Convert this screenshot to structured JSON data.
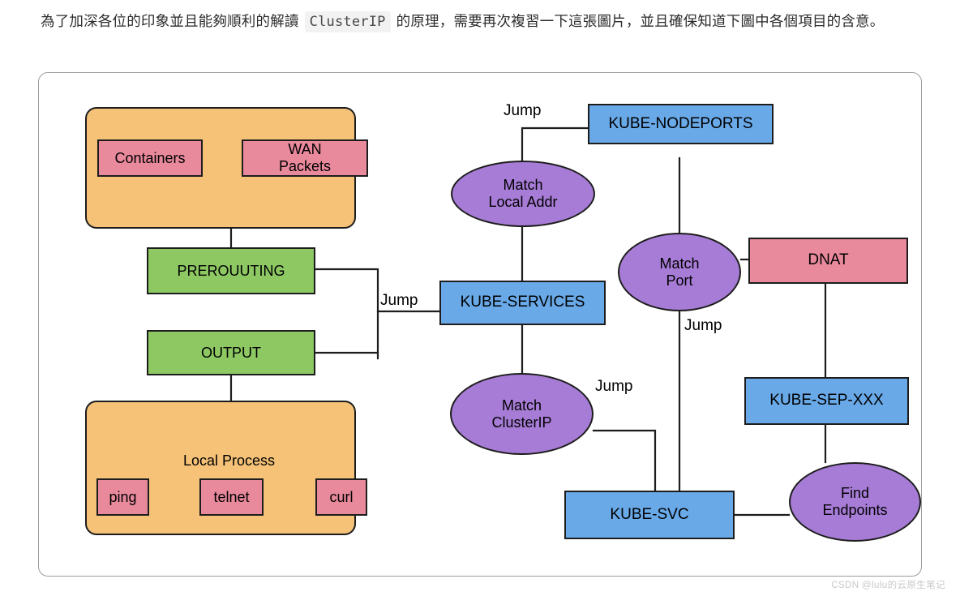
{
  "article": {
    "paragraph_part1": "為了加深各位的印象並且能夠順利的解讀 ",
    "inline_code": "ClusterIP",
    "paragraph_part2": " 的原理，需要再次複習一下這張圖片，並且確保知道下圖中各個項目的含意。"
  },
  "watermark": "CSDN @lulu的云原生笔记",
  "colors": {
    "group_orange": "#f5c278",
    "node_pink": "#e8899c",
    "node_green": "#8dc863",
    "node_blue": "#69a9e8",
    "node_purple": "#a77cd6",
    "stroke": "#1d1d1d",
    "card_border": "#9b9b9b"
  },
  "diagram": {
    "title": "Kubernetes ClusterIP iptables flow",
    "groups": [
      {
        "id": "ingress-group",
        "label": ""
      },
      {
        "id": "local-process-group",
        "label": "Local Process"
      }
    ],
    "nodes": [
      {
        "id": "containers",
        "label": "Containers",
        "shape": "rect",
        "fill": "pink"
      },
      {
        "id": "wan-packets",
        "label": "WAN\nPackets",
        "shape": "rect",
        "fill": "pink"
      },
      {
        "id": "prerouuting",
        "label": "PREROUUTING",
        "shape": "rect",
        "fill": "green"
      },
      {
        "id": "output",
        "label": "OUTPUT",
        "shape": "rect",
        "fill": "green"
      },
      {
        "id": "local-process",
        "label": "Local Process",
        "shape": "label",
        "fill": "none"
      },
      {
        "id": "ping",
        "label": "ping",
        "shape": "rect",
        "fill": "pink"
      },
      {
        "id": "telnet",
        "label": "telnet",
        "shape": "rect",
        "fill": "pink"
      },
      {
        "id": "curl",
        "label": "curl",
        "shape": "rect",
        "fill": "pink"
      },
      {
        "id": "kube-nodeports",
        "label": "KUBE-NODEPORTS",
        "shape": "rect",
        "fill": "blue"
      },
      {
        "id": "match-local-addr",
        "label": "Match\nLocal Addr",
        "shape": "ellipse",
        "fill": "purple"
      },
      {
        "id": "kube-services",
        "label": "KUBE-SERVICES",
        "shape": "rect",
        "fill": "blue"
      },
      {
        "id": "match-clusterip",
        "label": "Match\nClusterIP",
        "shape": "ellipse",
        "fill": "purple"
      },
      {
        "id": "match-port",
        "label": "Match\nPort",
        "shape": "ellipse",
        "fill": "purple"
      },
      {
        "id": "dnat",
        "label": "DNAT",
        "shape": "rect",
        "fill": "pink"
      },
      {
        "id": "kube-sep-xxx",
        "label": "KUBE-SEP-XXX",
        "shape": "rect",
        "fill": "blue"
      },
      {
        "id": "kube-svc",
        "label": "KUBE-SVC",
        "shape": "rect",
        "fill": "blue"
      },
      {
        "id": "find-endpoints",
        "label": "Find\nEndpoints",
        "shape": "ellipse",
        "fill": "purple"
      }
    ],
    "edge_labels": [
      {
        "id": "jump-nodeports",
        "label": "Jump"
      },
      {
        "id": "jump-services",
        "label": "Jump"
      },
      {
        "id": "jump-matchport",
        "label": "Jump"
      },
      {
        "id": "jump-clusterip",
        "label": "Jump"
      }
    ]
  }
}
